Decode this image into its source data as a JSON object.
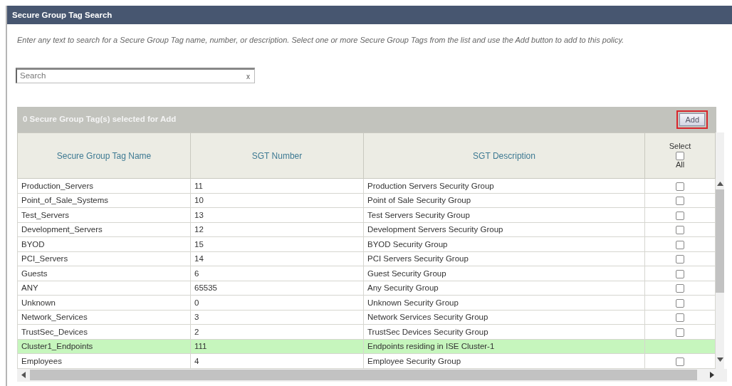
{
  "window": {
    "title": "Secure Group Tag Search"
  },
  "instructions": "Enter any text to search for a Secure Group Tag name, number, or description. Select one or more Secure Group Tags from the list and use the Add button to add to this policy.",
  "search": {
    "placeholder": "Search",
    "clear": "x"
  },
  "panel": {
    "title": "0 Secure Group Tag(s) selected for Add",
    "add_button": "Add"
  },
  "table": {
    "columns": [
      "Secure Group Tag Name",
      "SGT Number",
      "SGT Description"
    ],
    "select_all": {
      "label_top": "Select",
      "label_bottom": "All",
      "checked": false
    },
    "rows": [
      {
        "kind": "selectable",
        "name": "Production_Servers",
        "number": "11",
        "description": "Production Servers Security Group",
        "checked": false
      },
      {
        "kind": "selectable",
        "name": "Point_of_Sale_Systems",
        "number": "10",
        "description": "Point of Sale Security Group",
        "checked": false
      },
      {
        "kind": "selectable",
        "name": "Test_Servers",
        "number": "13",
        "description": "Test Servers Security Group",
        "checked": false
      },
      {
        "kind": "selectable",
        "name": "Development_Servers",
        "number": "12",
        "description": "Development Servers Security Group",
        "checked": false
      },
      {
        "kind": "selectable",
        "name": "BYOD",
        "number": "15",
        "description": "BYOD Security Group",
        "checked": false
      },
      {
        "kind": "selectable",
        "name": "PCI_Servers",
        "number": "14",
        "description": "PCI Servers Security Group",
        "checked": false
      },
      {
        "kind": "selectable",
        "name": "Guests",
        "number": "6",
        "description": "Guest Security Group",
        "checked": false
      },
      {
        "kind": "selectable",
        "name": "ANY",
        "number": "65535",
        "description": "Any Security Group",
        "checked": false
      },
      {
        "kind": "selectable",
        "name": "Unknown",
        "number": "0",
        "description": "Unknown Security Group",
        "checked": false
      },
      {
        "kind": "selectable",
        "name": "Network_Services",
        "number": "3",
        "description": "Network Services Security Group",
        "checked": false
      },
      {
        "kind": "selectable",
        "name": "TrustSec_Devices",
        "number": "2",
        "description": "TrustSec Devices Security Group",
        "checked": false
      },
      {
        "kind": "assigned",
        "name": "Cluster1_Endpoints",
        "number": "111",
        "description": "Endpoints residing in ISE Cluster-1"
      },
      {
        "kind": "selectable",
        "name": "Employees",
        "number": "4",
        "description": "Employee Security Group",
        "checked": false
      }
    ]
  }
}
